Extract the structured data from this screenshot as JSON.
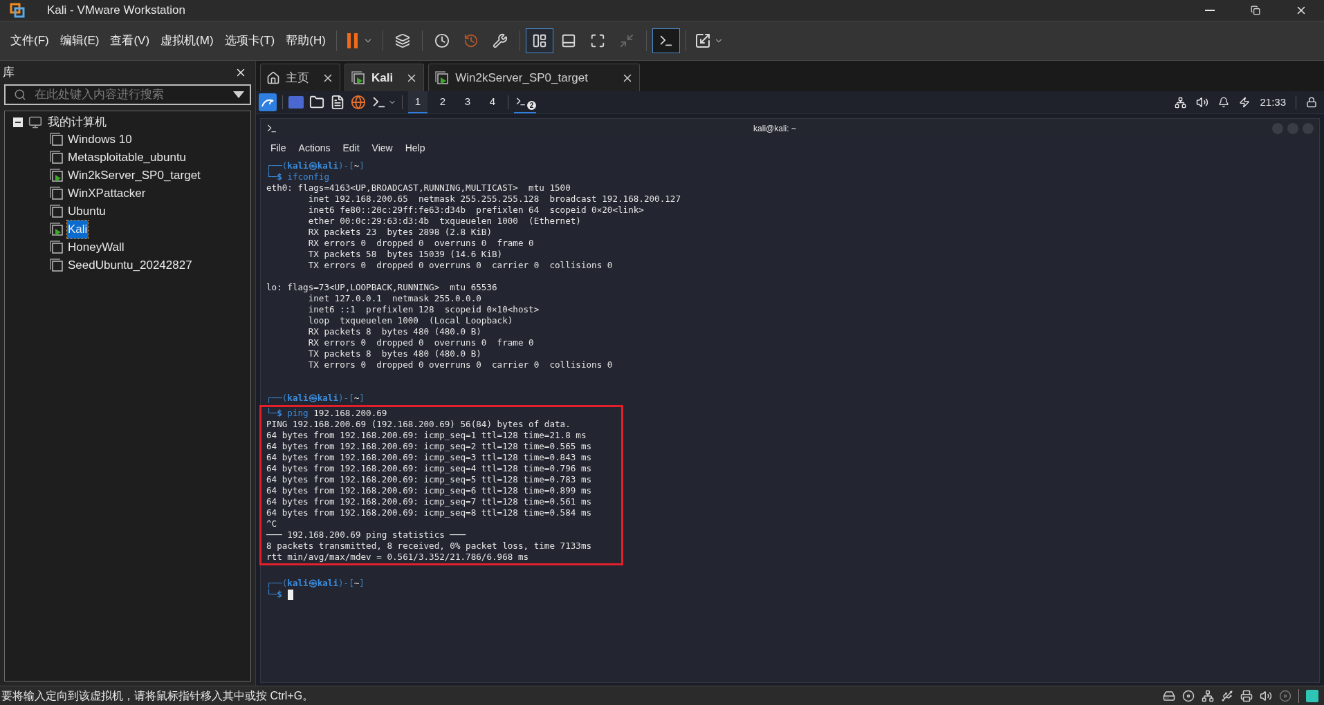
{
  "window": {
    "title": "Kali - VMware Workstation"
  },
  "menu": [
    "文件(F)",
    "编辑(E)",
    "查看(V)",
    "虚拟机(M)",
    "选项卡(T)",
    "帮助(H)"
  ],
  "library": {
    "title": "库",
    "search": {
      "placeholder": "在此处键入内容进行搜索"
    },
    "tree": [
      {
        "label": "我的计算机",
        "expanded": true,
        "children": [
          {
            "label": "Windows 10",
            "running": false,
            "selected": false
          },
          {
            "label": "Metasploitable_ubuntu",
            "running": false,
            "selected": false
          },
          {
            "label": "Win2kServer_SP0_target",
            "running": true,
            "selected": false
          },
          {
            "label": "WinXPattacker",
            "running": false,
            "selected": false
          },
          {
            "label": "Ubuntu",
            "running": false,
            "selected": false
          },
          {
            "label": "Kali",
            "running": true,
            "selected": true
          },
          {
            "label": "HoneyWall",
            "running": false,
            "selected": false
          },
          {
            "label": "SeedUbuntu_20242827",
            "running": false,
            "selected": false
          }
        ]
      }
    ]
  },
  "tabs": [
    {
      "kind": "home",
      "label": "主页",
      "selected": false
    },
    {
      "kind": "vm",
      "label": "Kali",
      "selected": true
    },
    {
      "kind": "vm",
      "label": "Win2kServer_SP0_target",
      "selected": false
    }
  ],
  "guest_panel": {
    "workspaces": [
      {
        "label": "1",
        "selected": true
      },
      {
        "label": "2",
        "selected": false
      },
      {
        "label": "3",
        "selected": false
      },
      {
        "label": "4",
        "selected": false
      }
    ],
    "window_count": "2",
    "clock": "21:33"
  },
  "terminal": {
    "title": "kali@kali: ~",
    "menu": [
      "File",
      "Actions",
      "Edit",
      "View",
      "Help"
    ],
    "blocks": [
      {
        "highlighted": false,
        "lines": [
          {
            "kind": "prompt",
            "segments": [
              {
                "kind": "frame",
                "text": "┌──("
              },
              {
                "kind": "user",
                "text": "kali㉿kali"
              },
              {
                "kind": "frame",
                "text": ")-["
              },
              {
                "kind": "plain",
                "text": "~"
              },
              {
                "kind": "frame",
                "text": "]"
              }
            ]
          },
          {
            "kind": "command",
            "segments": [
              {
                "kind": "dollar",
                "text": "└─$"
              },
              {
                "kind": "cmd",
                "text": " ifconfig"
              }
            ]
          },
          {
            "kind": "output",
            "text": "eth0: flags=4163<UP,BROADCAST,RUNNING,MULTICAST>  mtu 1500"
          },
          {
            "kind": "output",
            "text": "        inet 192.168.200.65  netmask 255.255.255.128  broadcast 192.168.200.127"
          },
          {
            "kind": "output",
            "text": "        inet6 fe80::20c:29ff:fe63:d34b  prefixlen 64  scopeid 0×20<link>"
          },
          {
            "kind": "output",
            "text": "        ether 00:0c:29:63:d3:4b  txqueuelen 1000  (Ethernet)"
          },
          {
            "kind": "output",
            "text": "        RX packets 23  bytes 2898 (2.8 KiB)"
          },
          {
            "kind": "output",
            "text": "        RX errors 0  dropped 0  overruns 0  frame 0"
          },
          {
            "kind": "output",
            "text": "        TX packets 58  bytes 15039 (14.6 KiB)"
          },
          {
            "kind": "output",
            "text": "        TX errors 0  dropped 0 overruns 0  carrier 0  collisions 0"
          },
          {
            "kind": "blank"
          },
          {
            "kind": "output",
            "text": "lo: flags=73<UP,LOOPBACK,RUNNING>  mtu 65536"
          },
          {
            "kind": "output",
            "text": "        inet 127.0.0.1  netmask 255.0.0.0"
          },
          {
            "kind": "output",
            "text": "        inet6 ::1  prefixlen 128  scopeid 0×10<host>"
          },
          {
            "kind": "output",
            "text": "        loop  txqueuelen 1000  (Local Loopback)"
          },
          {
            "kind": "output",
            "text": "        RX packets 8  bytes 480 (480.0 B)"
          },
          {
            "kind": "output",
            "text": "        RX errors 0  dropped 0  overruns 0  frame 0"
          },
          {
            "kind": "output",
            "text": "        TX packets 8  bytes 480 (480.0 B)"
          },
          {
            "kind": "output",
            "text": "        TX errors 0  dropped 0 overruns 0  carrier 0  collisions 0"
          },
          {
            "kind": "blank"
          },
          {
            "kind": "blank"
          },
          {
            "kind": "prompt",
            "segments": [
              {
                "kind": "frame",
                "text": "┌──("
              },
              {
                "kind": "user",
                "text": "kali㉿kali"
              },
              {
                "kind": "frame",
                "text": ")-["
              },
              {
                "kind": "plain",
                "text": "~"
              },
              {
                "kind": "frame",
                "text": "]"
              }
            ]
          }
        ]
      },
      {
        "highlighted": true,
        "lines": [
          {
            "kind": "command",
            "segments": [
              {
                "kind": "dollar",
                "text": "└─$"
              },
              {
                "kind": "cmd",
                "text": " ping"
              },
              {
                "kind": "plain",
                "text": " 192.168.200.69"
              }
            ]
          },
          {
            "kind": "output",
            "text": "PING 192.168.200.69 (192.168.200.69) 56(84) bytes of data."
          },
          {
            "kind": "output",
            "text": "64 bytes from 192.168.200.69: icmp_seq=1 ttl=128 time=21.8 ms"
          },
          {
            "kind": "output",
            "text": "64 bytes from 192.168.200.69: icmp_seq=2 ttl=128 time=0.565 ms"
          },
          {
            "kind": "output",
            "text": "64 bytes from 192.168.200.69: icmp_seq=3 ttl=128 time=0.843 ms"
          },
          {
            "kind": "output",
            "text": "64 bytes from 192.168.200.69: icmp_seq=4 ttl=128 time=0.796 ms"
          },
          {
            "kind": "output",
            "text": "64 bytes from 192.168.200.69: icmp_seq=5 ttl=128 time=0.783 ms"
          },
          {
            "kind": "output",
            "text": "64 bytes from 192.168.200.69: icmp_seq=6 ttl=128 time=0.899 ms"
          },
          {
            "kind": "output",
            "text": "64 bytes from 192.168.200.69: icmp_seq=7 ttl=128 time=0.561 ms"
          },
          {
            "kind": "output",
            "text": "64 bytes from 192.168.200.69: icmp_seq=8 ttl=128 time=0.584 ms"
          },
          {
            "kind": "output",
            "text": "^C"
          },
          {
            "kind": "output",
            "text": "─── 192.168.200.69 ping statistics ───"
          },
          {
            "kind": "output",
            "text": "8 packets transmitted, 8 received, 0% packet loss, time 7133ms"
          },
          {
            "kind": "output",
            "text": "rtt min/avg/max/mdev = 0.561/3.352/21.786/6.968 ms"
          }
        ]
      },
      {
        "highlighted": false,
        "lines": [
          {
            "kind": "blank"
          },
          {
            "kind": "prompt",
            "segments": [
              {
                "kind": "frame",
                "text": "┌──("
              },
              {
                "kind": "user",
                "text": "kali㉿kali"
              },
              {
                "kind": "frame",
                "text": ")-["
              },
              {
                "kind": "plain",
                "text": "~"
              },
              {
                "kind": "frame",
                "text": "]"
              }
            ]
          },
          {
            "kind": "command",
            "cursor": true,
            "segments": [
              {
                "kind": "dollar",
                "text": "└─$"
              }
            ]
          }
        ]
      }
    ]
  },
  "status_bar": {
    "text": "要将输入定向到该虚拟机，请将鼠标指针移入其中或按 Ctrl+G。"
  }
}
